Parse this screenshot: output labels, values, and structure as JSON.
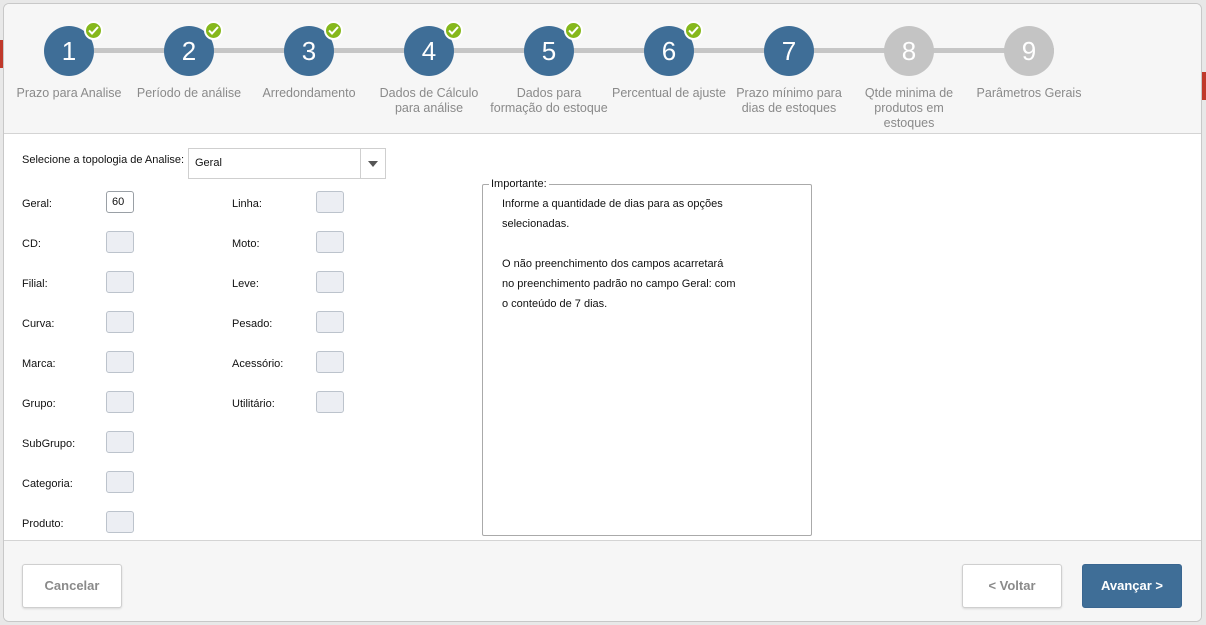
{
  "wizard": {
    "steps": [
      {
        "number": "1",
        "label": "Prazo para Analise",
        "completed": true
      },
      {
        "number": "2",
        "label": "Período de análise",
        "completed": true
      },
      {
        "number": "3",
        "label": "Arredondamento",
        "completed": true
      },
      {
        "number": "4",
        "label": "Dados de Cálculo para análise",
        "completed": true
      },
      {
        "number": "5",
        "label": "Dados para formação do estoque",
        "completed": true
      },
      {
        "number": "6",
        "label": "Percentual de ajuste",
        "completed": true
      },
      {
        "number": "7",
        "label": "Prazo mínimo para dias de estoques",
        "completed": false,
        "current": true
      },
      {
        "number": "8",
        "label": "Qtde minima de produtos em estoques",
        "completed": false
      },
      {
        "number": "9",
        "label": "Parâmetros Gerais",
        "completed": false
      }
    ]
  },
  "form": {
    "topology_label": "Selecione a topologia de Analise:",
    "topology_value": "Geral",
    "left_fields": [
      {
        "label": "Geral:",
        "value": "60"
      },
      {
        "label": "CD:",
        "value": ""
      },
      {
        "label": "Filial:",
        "value": ""
      },
      {
        "label": "Curva:",
        "value": ""
      },
      {
        "label": "Marca:",
        "value": ""
      },
      {
        "label": "Grupo:",
        "value": ""
      },
      {
        "label": "SubGrupo:",
        "value": ""
      },
      {
        "label": "Categoria:",
        "value": ""
      },
      {
        "label": "Produto:",
        "value": ""
      }
    ],
    "right_fields": [
      {
        "label": "Linha:",
        "value": ""
      },
      {
        "label": "Moto:",
        "value": ""
      },
      {
        "label": "Leve:",
        "value": ""
      },
      {
        "label": "Pesado:",
        "value": ""
      },
      {
        "label": "Acessório:",
        "value": ""
      },
      {
        "label": "Utilitário:",
        "value": ""
      }
    ]
  },
  "notice": {
    "legend": "Importante:",
    "lines": [
      "Informe a quantidade de dias para as opções",
      "selecionadas.",
      "",
      "O não preenchimento dos campos acarretará",
      "no preenchimento padrão no campo Geral: com",
      "o conteúdo de 7 dias."
    ]
  },
  "footer": {
    "cancel_label": "Cancelar",
    "back_label": "< Voltar",
    "next_label": "Avançar >"
  },
  "colors": {
    "step_done": "#3f6e97",
    "step_todo": "#c4c4c4",
    "check": "#86b81c",
    "primary": "#3f6e97"
  }
}
